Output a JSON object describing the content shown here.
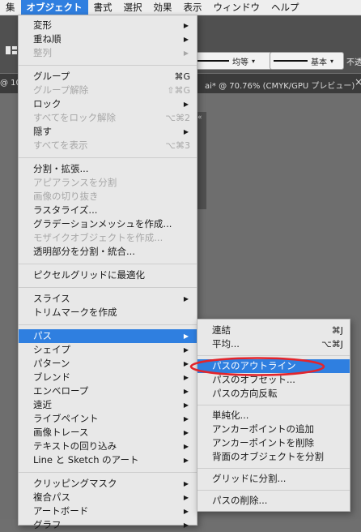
{
  "menubar": {
    "items": [
      {
        "label": "集"
      },
      {
        "label": "オブジェクト",
        "active": true
      },
      {
        "label": "書式"
      },
      {
        "label": "選択"
      },
      {
        "label": "効果"
      },
      {
        "label": "表示"
      },
      {
        "label": "ウィンドウ"
      },
      {
        "label": "ヘルプ"
      }
    ]
  },
  "control_bar": {
    "stroke1": "均等",
    "stroke2": "基本",
    "opacity_label": "不透"
  },
  "doc_tab": {
    "left_text": "@ 10",
    "right_text": "ai* @ 70.76% (CMYK/GPU プレビュー)",
    "close_glyph": "×"
  },
  "panel": {
    "icon_glyph": "«"
  },
  "object_menu": {
    "items": [
      {
        "label": "変形",
        "arrow": true
      },
      {
        "label": "重ね順",
        "arrow": true
      },
      {
        "label": "整列",
        "arrow": true,
        "disabled": true
      },
      {
        "sep": true
      },
      {
        "label": "グループ",
        "shortcut": "⌘G"
      },
      {
        "label": "グループ解除",
        "shortcut": "⇧⌘G",
        "disabled": true
      },
      {
        "label": "ロック",
        "arrow": true
      },
      {
        "label": "すべてをロック解除",
        "shortcut": "⌥⌘2",
        "disabled": true
      },
      {
        "label": "隠す",
        "arrow": true
      },
      {
        "label": "すべてを表示",
        "shortcut": "⌥⌘3",
        "disabled": true
      },
      {
        "sep": true
      },
      {
        "label": "分割・拡張..."
      },
      {
        "label": "アピアランスを分割",
        "disabled": true
      },
      {
        "label": "画像の切り抜き",
        "disabled": true
      },
      {
        "label": "ラスタライズ..."
      },
      {
        "label": "グラデーションメッシュを作成..."
      },
      {
        "label": "モザイクオブジェクトを作成...",
        "disabled": true
      },
      {
        "label": "透明部分を分割・統合..."
      },
      {
        "sep": true
      },
      {
        "label": "ピクセルグリッドに最適化"
      },
      {
        "sep": true
      },
      {
        "label": "スライス",
        "arrow": true
      },
      {
        "label": "トリムマークを作成"
      },
      {
        "sep": true
      },
      {
        "label": "パス",
        "arrow": true,
        "selected": true
      },
      {
        "label": "シェイプ",
        "arrow": true
      },
      {
        "label": "パターン",
        "arrow": true
      },
      {
        "label": "ブレンド",
        "arrow": true
      },
      {
        "label": "エンベロープ",
        "arrow": true
      },
      {
        "label": "遠近",
        "arrow": true
      },
      {
        "label": "ライブペイント",
        "arrow": true
      },
      {
        "label": "画像トレース",
        "arrow": true
      },
      {
        "label": "テキストの回り込み",
        "arrow": true
      },
      {
        "label": "Line と Sketch のアート",
        "arrow": true
      },
      {
        "sep": true
      },
      {
        "label": "クリッピングマスク",
        "arrow": true
      },
      {
        "label": "複合パス",
        "arrow": true
      },
      {
        "label": "アートボード",
        "arrow": true
      },
      {
        "label": "グラフ",
        "arrow": true
      }
    ]
  },
  "path_submenu": {
    "items": [
      {
        "label": "連結",
        "shortcut": "⌘J"
      },
      {
        "label": "平均...",
        "shortcut": "⌥⌘J"
      },
      {
        "sep": true
      },
      {
        "label": "パスのアウトライン",
        "selected": true
      },
      {
        "label": "パスのオフセット..."
      },
      {
        "label": "パスの方向反転"
      },
      {
        "sep": true
      },
      {
        "label": "単純化..."
      },
      {
        "label": "アンカーポイントの追加"
      },
      {
        "label": "アンカーポイントを削除"
      },
      {
        "label": "背面のオブジェクトを分割"
      },
      {
        "sep": true
      },
      {
        "label": "グリッドに分割..."
      },
      {
        "sep": true
      },
      {
        "label": "パスの削除..."
      }
    ]
  },
  "annotation": {
    "color": "#e3242b"
  },
  "colors": {
    "accent": "#2f7fe0"
  }
}
